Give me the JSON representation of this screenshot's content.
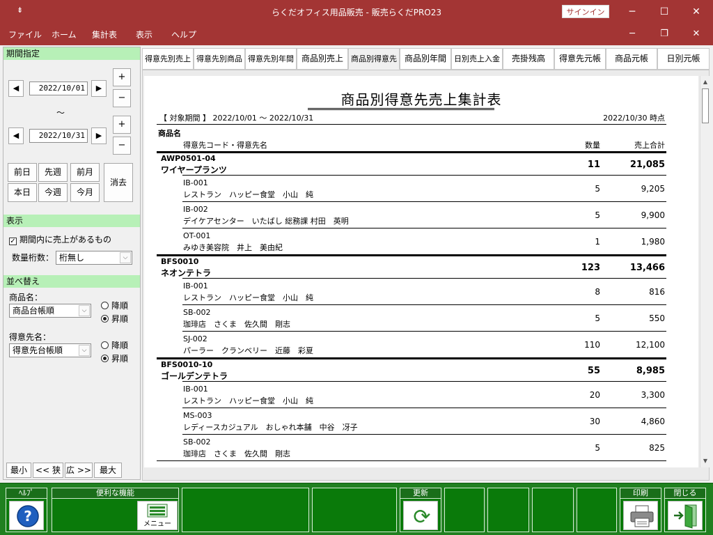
{
  "window": {
    "app_icon": "⇟",
    "title": "らくだオフィス用品販売  -  販売らくだPRO23",
    "signin": "サインイン",
    "minimize": "─",
    "maximize": "☐",
    "close": "✕"
  },
  "menu": {
    "items": [
      "ファイル",
      "ホーム",
      "集計表",
      "表示",
      "ヘルプ"
    ],
    "mdi_min": "─",
    "mdi_restore": "❐",
    "mdi_close": "✕"
  },
  "left": {
    "period_head": "期間指定",
    "date_from": "2022/10/01",
    "date_to": "2022/10/31",
    "prev_arrow": "◀",
    "next_arrow": "▶",
    "plus": "+",
    "minus": "−",
    "tilde": "〜",
    "buttons": [
      "前日",
      "先週",
      "前月",
      "本日",
      "今週",
      "今月"
    ],
    "clear": "消去",
    "display_head": "表示",
    "check_label": "期間内に売上があるもの",
    "check_mark": "✓",
    "qty_digits_label": "数量桁数：",
    "qty_digits_value": "桁無し",
    "dropdown_glyph": "⌵",
    "sort_head": "並べ替え",
    "product_label": "商品名：",
    "product_sort": "商品台帳順",
    "customer_label": "得意先名：",
    "customer_sort": "得意先台帳順",
    "desc": "降順",
    "asc": "昇順",
    "zoom": [
      "最小",
      "<< 狭",
      "広 >>",
      "最大"
    ]
  },
  "tabs": [
    "得意先別売上",
    "得意先別商品",
    "得意先別年間",
    "商品別売上",
    "商品別得意先",
    "商品別年間",
    "日別売上入金",
    "売掛残高",
    "得意先元帳",
    "商品元帳",
    "日別元帳"
  ],
  "report": {
    "title": "商品別得意先売上集計表",
    "period": "【 対象期間 】 2022/10/01 〜 2022/10/31",
    "as_of": "2022/10/30 時点",
    "col_product": "商品名",
    "col_customer": "得意先コード・得意先名",
    "col_qty": "数量",
    "col_amount": "売上合計",
    "groups": [
      {
        "code": "AWP0501-04",
        "name": "ワイヤープランツ",
        "qty": "11",
        "amount": "21,085",
        "rows": [
          {
            "code": "IB-001",
            "name": "レストラン　ハッピー食堂　小山　純",
            "qty": "5",
            "amount": "9,205"
          },
          {
            "code": "IB-002",
            "name": "デイケアセンター　いたばし 総務課 村田　英明",
            "qty": "5",
            "amount": "9,900"
          },
          {
            "code": "OT-001",
            "name": "みゆき美容院　井上　美由紀",
            "qty": "1",
            "amount": "1,980"
          }
        ]
      },
      {
        "code": "BFS0010",
        "name": "ネオンテトラ",
        "qty": "123",
        "amount": "13,466",
        "rows": [
          {
            "code": "IB-001",
            "name": "レストラン　ハッピー食堂　小山　純",
            "qty": "8",
            "amount": "816"
          },
          {
            "code": "SB-002",
            "name": "珈琲店　さくま　佐久間　剛志",
            "qty": "5",
            "amount": "550"
          },
          {
            "code": "SJ-002",
            "name": "パーラー　クランベリー　近藤　彩夏",
            "qty": "110",
            "amount": "12,100"
          }
        ]
      },
      {
        "code": "BFS0010-10",
        "name": "ゴールデンテトラ",
        "qty": "55",
        "amount": "8,985",
        "rows": [
          {
            "code": "IB-001",
            "name": "レストラン　ハッピー食堂　小山　純",
            "qty": "20",
            "amount": "3,300"
          },
          {
            "code": "MS-003",
            "name": "レディースカジュアル　おしゃれ本舗　中谷　冴子",
            "qty": "30",
            "amount": "4,860"
          },
          {
            "code": "SB-002",
            "name": "珈琲店　さくま　佐久間　剛志",
            "qty": "5",
            "amount": "825"
          }
        ]
      }
    ]
  },
  "scroll": {
    "up": "▲",
    "down": "▼"
  },
  "bottom": {
    "help_label": "ﾍﾙﾌﾟ",
    "help_glyph": "?",
    "tools_label": "便利な機能",
    "menu_text": "メニュー",
    "refresh_label": "更新",
    "refresh_glyph": "⟳",
    "print_label": "印刷",
    "close_label": "閉じる"
  }
}
